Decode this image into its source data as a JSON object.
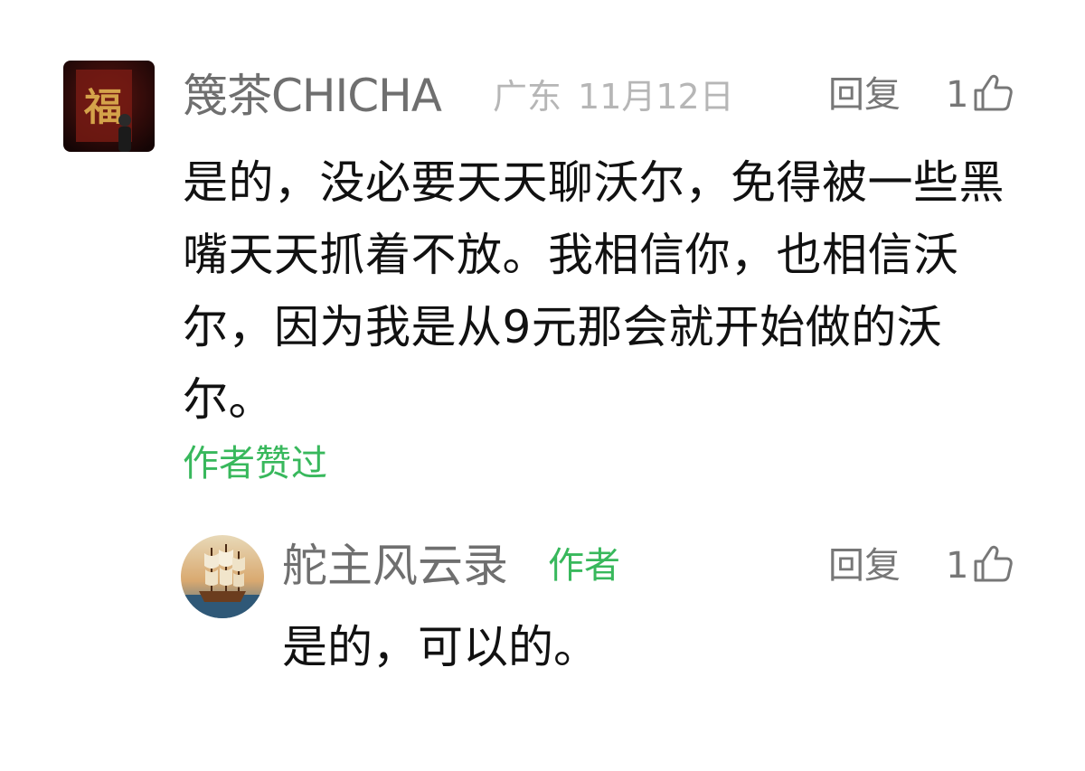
{
  "comment": {
    "username": "篾茶CHICHA",
    "location": "广东",
    "date": "11月12日",
    "reply_label": "回复",
    "like_count": "1",
    "text": "是的，没必要天天聊沃尔，免得被一些黑嘴天天抓着不放。我相信你，也相信沃尔，因为我是从9元那会就开始做的沃尔。",
    "author_liked": "作者赞过",
    "avatar_text": "福"
  },
  "reply": {
    "username": "舵主风云录",
    "author_badge": "作者",
    "reply_label": "回复",
    "like_count": "1",
    "text": "是的，可以的。"
  },
  "colors": {
    "username": "#6f6f6f",
    "meta": "#b6b6b6",
    "action": "#777777",
    "accent_green": "#38b85c",
    "text": "#111111"
  }
}
